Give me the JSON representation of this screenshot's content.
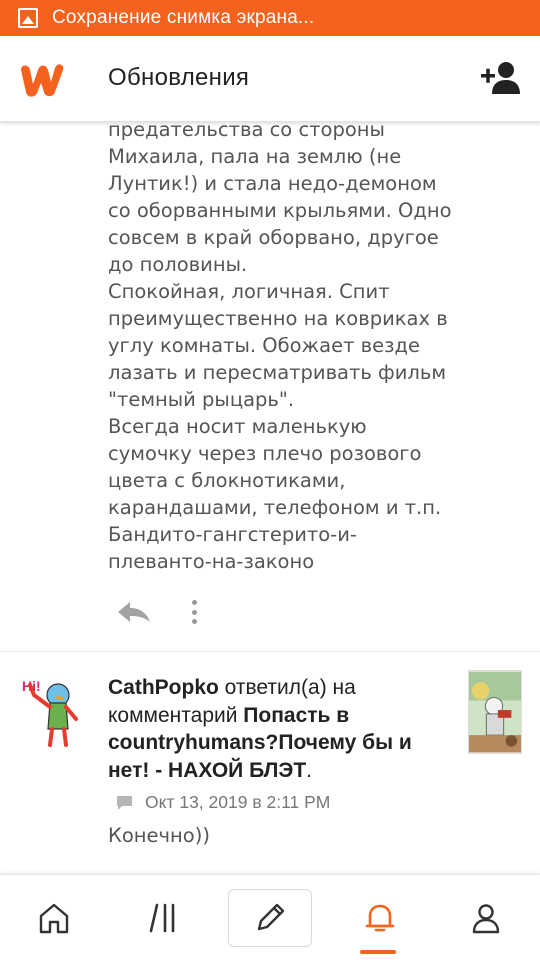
{
  "status_bar": {
    "text": "Сохранение снимка экрана...",
    "icon": "image-icon",
    "bg_color": "#f5621e"
  },
  "header": {
    "title": "Обновления",
    "logo": "wattpad-logo",
    "add_friend_icon": "add-person-icon",
    "accent_color": "#f5621e"
  },
  "story": {
    "lines": [
      "предательства со стороны",
      "Михаила, пала на землю (не",
      "Лунтик!) и стала недо-демоном",
      "со оборванными крыльями. Одно",
      "совсем в край оборвано, другое",
      "до половины.",
      "Спокойная, логичная. Спит",
      "преимущественно на ковриках в",
      "углу комнаты. Обожает везде",
      "лазать и пересматривать фильм",
      "\"темный рыцарь\".",
      "Всегда носит маленькую",
      "сумочку через плечо розового",
      "цвета с блокнотиками,",
      "карандашами, телефоном и т.п.",
      "Бандито-гангстерито-и-",
      "плеванто-на-законо"
    ],
    "actions": {
      "reply_icon": "reply-arrow-icon",
      "more_icon": "more-vertical-icon"
    }
  },
  "notification": {
    "username": "CathPopko",
    "action_text": " ответил(а) на комментарий ",
    "story_title": "Попасть в countryhumans?Почему бы и нет! - НАХОЙ БЛЭТ",
    "trailing": ".",
    "timestamp": "Окт 13, 2019 в 2:11 PM",
    "reply": "Конечно))",
    "avatar_icon": "avatar-hi-character",
    "cover_icon": "story-cover-thumbnail",
    "comment_icon": "comment-bubble-icon"
  },
  "bottom_nav": {
    "items": [
      {
        "name": "home",
        "icon": "home-icon",
        "active": false
      },
      {
        "name": "library",
        "icon": "library-icon",
        "active": false
      },
      {
        "name": "write",
        "icon": "pencil-icon",
        "active": false
      },
      {
        "name": "notifications",
        "icon": "bell-icon",
        "active": true
      },
      {
        "name": "profile",
        "icon": "person-icon",
        "active": false
      }
    ]
  }
}
